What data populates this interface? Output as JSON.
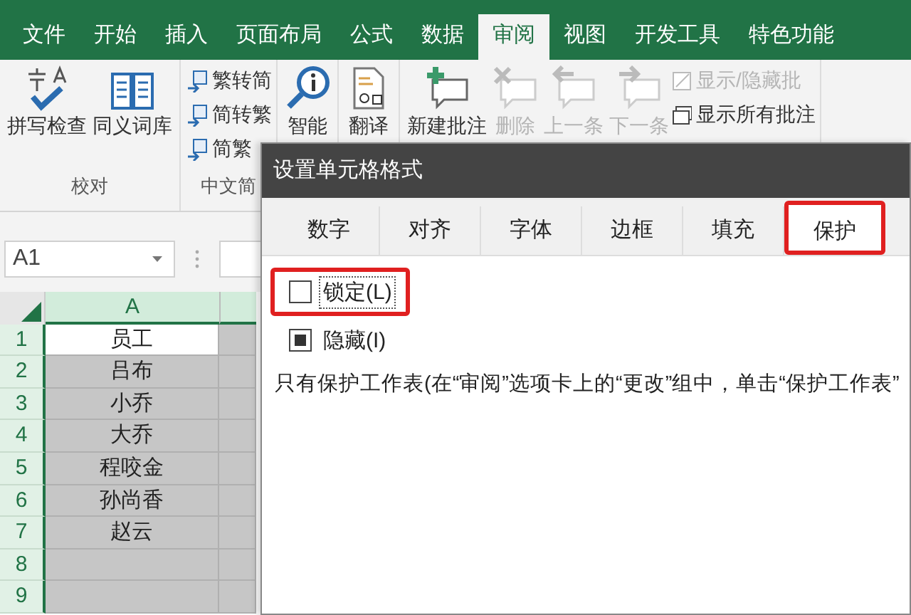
{
  "ribbon_tabs": [
    {
      "label": "文件",
      "selected": false
    },
    {
      "label": "开始",
      "selected": false
    },
    {
      "label": "插入",
      "selected": false
    },
    {
      "label": "页面布局",
      "selected": false
    },
    {
      "label": "公式",
      "selected": false
    },
    {
      "label": "数据",
      "selected": false
    },
    {
      "label": "审阅",
      "selected": true
    },
    {
      "label": "视图",
      "selected": false
    },
    {
      "label": "开发工具",
      "selected": false
    },
    {
      "label": "特色功能",
      "selected": false
    }
  ],
  "ribbon_groups": [
    {
      "label": "校对",
      "buttons": [
        {
          "kind": "large",
          "label": "拼写检查",
          "disabled": false
        },
        {
          "kind": "large",
          "label": "同义词库",
          "disabled": false
        }
      ]
    },
    {
      "label": "中文简",
      "buttons": [
        {
          "kind": "small",
          "label": "繁转简",
          "disabled": false
        },
        {
          "kind": "small",
          "label": "简转繁",
          "disabled": false
        },
        {
          "kind": "small",
          "label": "简繁",
          "disabled": false
        }
      ]
    },
    {
      "buttons": [
        {
          "kind": "large",
          "label": "智能",
          "disabled": false
        }
      ]
    },
    {
      "buttons": [
        {
          "kind": "large",
          "label": "翻译",
          "disabled": false
        }
      ]
    },
    {
      "buttons": [
        {
          "kind": "large",
          "label": "新建批注",
          "disabled": false
        },
        {
          "kind": "large",
          "label": "删除",
          "disabled": true
        },
        {
          "kind": "large",
          "label": "上一条",
          "disabled": true
        },
        {
          "kind": "large",
          "label": "下一条",
          "disabled": true
        },
        {
          "kind": "small",
          "label": "显示/隐藏批",
          "disabled": true
        },
        {
          "kind": "small",
          "label": "显示所有批注",
          "disabled": false
        }
      ]
    }
  ],
  "name_box": {
    "value": "A1"
  },
  "sheet": {
    "columns": [
      "A"
    ],
    "rows": [
      {
        "header": "1",
        "cells": [
          {
            "text": "员工",
            "active": true
          },
          {
            "active": false
          }
        ]
      },
      {
        "header": "2",
        "cells": [
          {
            "text": "吕布",
            "active": false
          },
          {
            "active": false
          }
        ]
      },
      {
        "header": "3",
        "cells": [
          {
            "text": "小乔",
            "active": false
          },
          {
            "active": false
          }
        ]
      },
      {
        "header": "4",
        "cells": [
          {
            "text": "大乔",
            "active": false
          },
          {
            "active": false
          }
        ]
      },
      {
        "header": "5",
        "cells": [
          {
            "text": "程咬金",
            "active": false
          },
          {
            "active": false
          }
        ]
      },
      {
        "header": "6",
        "cells": [
          {
            "text": "孙尚香",
            "active": false
          },
          {
            "active": false
          }
        ]
      },
      {
        "header": "7",
        "cells": [
          {
            "text": "赵云",
            "active": false
          },
          {
            "active": false
          }
        ]
      },
      {
        "header": "8",
        "cells": [
          {
            "active": false
          },
          {
            "active": false
          }
        ]
      },
      {
        "header": "9",
        "cells": [
          {
            "active": false
          },
          {
            "active": false
          }
        ]
      }
    ]
  },
  "dialog": {
    "title": "设置单元格格式",
    "tabs": [
      {
        "label": "数字",
        "selected": false,
        "highlighted": false
      },
      {
        "label": "对齐",
        "selected": false,
        "highlighted": false
      },
      {
        "label": "字体",
        "selected": false,
        "highlighted": false
      },
      {
        "label": "边框",
        "selected": false,
        "highlighted": false
      },
      {
        "label": "填充",
        "selected": false,
        "highlighted": false
      },
      {
        "label": "保护",
        "selected": true,
        "highlighted": true
      }
    ],
    "options": [
      {
        "label": "锁定(L)",
        "checked": false,
        "highlighted": true
      },
      {
        "label": "隐藏(I)",
        "checked": true,
        "highlighted": false
      }
    ],
    "note": "只有保护工作表(在“审阅”选项卡上的“更改”组中，单击“保护工作表”"
  }
}
